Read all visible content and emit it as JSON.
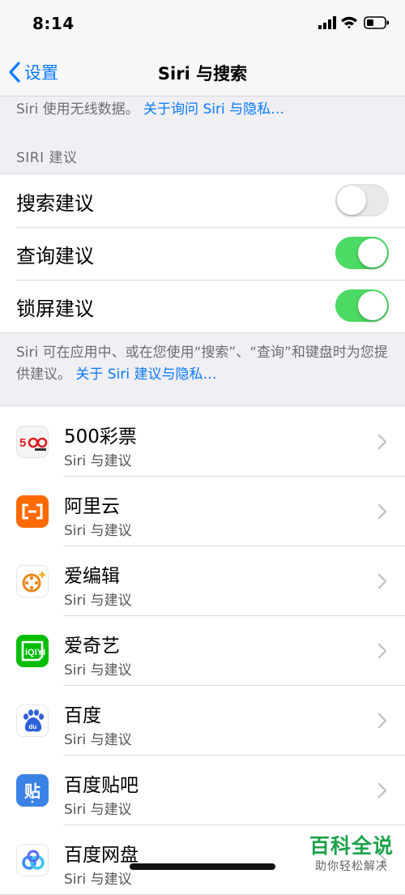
{
  "status": {
    "time": "8:14"
  },
  "nav": {
    "back_label": "设置",
    "title": "Siri 与搜索"
  },
  "top_note": {
    "text": "Siri 使用无线数据。",
    "link": "关于询问 Siri 与隐私…"
  },
  "section_header": "SIRI 建议",
  "toggles": [
    {
      "label": "搜索建议",
      "state": "off"
    },
    {
      "label": "查询建议",
      "state": "on"
    },
    {
      "label": "锁屏建议",
      "state": "on"
    }
  ],
  "footer": {
    "text": "Siri 可在应用中、或在您使用“搜索”、“查询”和键盘时为您提供建议。",
    "link": "关于 Siri 建议与隐私…"
  },
  "apps": [
    {
      "name": "500彩票",
      "sub": "Siri 与建议",
      "icon": "lottery-500-icon"
    },
    {
      "name": "阿里云",
      "sub": "Siri 与建议",
      "icon": "aliyun-icon"
    },
    {
      "name": "爱编辑",
      "sub": "Siri 与建议",
      "icon": "ai-bianji-icon"
    },
    {
      "name": "爱奇艺",
      "sub": "Siri 与建议",
      "icon": "iqiyi-icon"
    },
    {
      "name": "百度",
      "sub": "Siri 与建议",
      "icon": "baidu-icon"
    },
    {
      "name": "百度贴吧",
      "sub": "Siri 与建议",
      "icon": "baidu-tieba-icon"
    },
    {
      "name": "百度网盘",
      "sub": "Siri 与建议",
      "icon": "baidu-netdisk-icon"
    }
  ],
  "watermark": {
    "title": "百科全说",
    "subtitle": "助你轻松解决"
  },
  "colors": {
    "accent": "#0a7aff",
    "toggle_on": "#4cd964",
    "background": "#efeff4"
  }
}
